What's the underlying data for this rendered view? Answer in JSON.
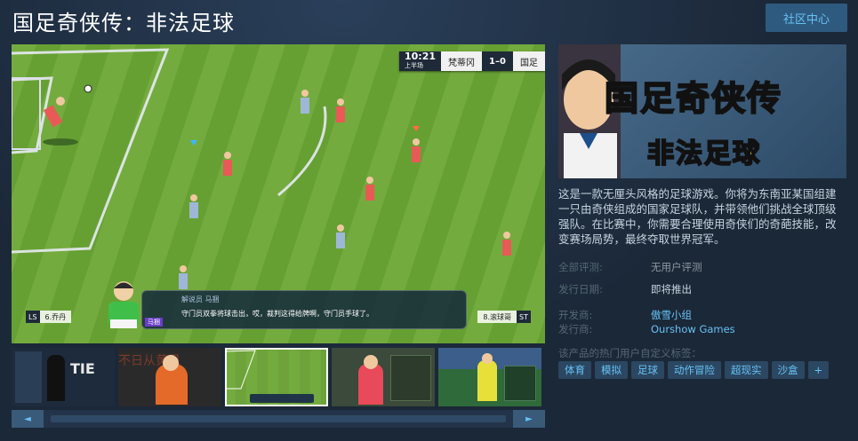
{
  "page": {
    "title": "国足奇侠传：非法足球",
    "community_button": "社区中心"
  },
  "screenshot": {
    "scoreboard": {
      "time": "10:21",
      "half": "上半场",
      "home_team": "梵蒂冈",
      "score": "1–0",
      "away_team": "国足"
    },
    "commentary": {
      "speaker": "解说员 马捆",
      "line": "守门员双拳将球击出，哎，裁判这得给牌啊，守门员手球了。",
      "commentator_tag": "马捆"
    },
    "left_player": {
      "abbr": "LS",
      "name": "6.乔丹"
    },
    "right_player": {
      "abbr": "ST",
      "name": "8.滚球哥"
    }
  },
  "capsule": {
    "title": "国足奇侠传",
    "subtitle": "非法足球"
  },
  "description": "这是一款无厘头风格的足球游戏。你将为东南亚某国组建一只由奇侠组成的国家足球队，并带领他们挑战全球顶级强队。在比赛中，你需要合理使用奇侠们的奇葩技能，改变赛场局势，最终夺取世界冠军。",
  "meta": {
    "reviews_label": "全部评测:",
    "reviews_value": "无用户评测",
    "release_label": "发行日期:",
    "release_value": "即将推出",
    "developer_label": "开发商:",
    "developer_value": "傲雪小组",
    "publisher_label": "发行商:",
    "publisher_value": "Ourshow Games"
  },
  "tags": {
    "label": "该产品的热门用户自定义标签：",
    "items": [
      "体育",
      "模拟",
      "足球",
      "动作冒险",
      "超现实",
      "沙盒",
      "+"
    ]
  },
  "thumb_texts": {
    "t1": "TIE",
    "t2": "不日从黄见"
  },
  "scroll": {
    "left": "◄",
    "right": "►"
  },
  "colors": {
    "background": "#1b2838",
    "link": "#67c1f5",
    "tag_bg": "#2b4761",
    "pitch": "#6da33a"
  }
}
